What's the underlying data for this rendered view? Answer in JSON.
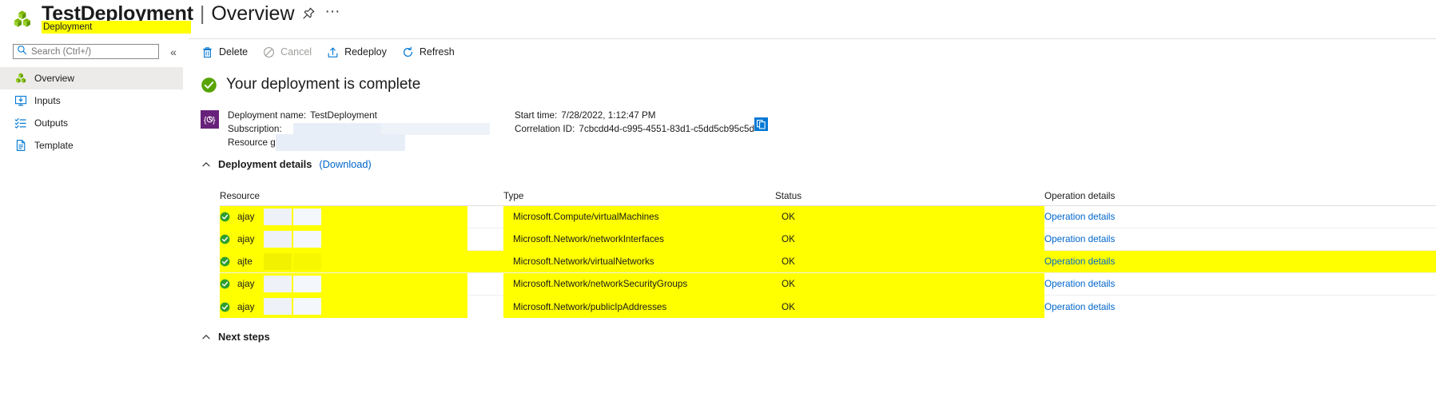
{
  "header": {
    "resource_icon": "cubes-icon",
    "title": "TestDeployment",
    "separator": "|",
    "subtitle_view": "Overview",
    "badge": "Deployment",
    "pin_icon": "pin-icon",
    "more_icon": "ellipsis-icon"
  },
  "search": {
    "placeholder": "Search (Ctrl+/)",
    "value": "",
    "icon": "search-icon",
    "collapse_icon": "chevron-double-left-icon"
  },
  "sidebar": {
    "items": [
      {
        "label": "Overview",
        "icon": "cubes-icon",
        "active": true
      },
      {
        "label": "Inputs",
        "icon": "inputs-monitor-icon",
        "active": false
      },
      {
        "label": "Outputs",
        "icon": "outputs-list-icon",
        "active": false
      },
      {
        "label": "Template",
        "icon": "document-icon",
        "active": false
      }
    ]
  },
  "command_bar": {
    "items": [
      {
        "label": "Delete",
        "icon": "trash-icon",
        "disabled": false
      },
      {
        "label": "Cancel",
        "icon": "cancel-circle-icon",
        "disabled": true
      },
      {
        "label": "Redeploy",
        "icon": "upload-box-icon",
        "disabled": false
      },
      {
        "label": "Refresh",
        "icon": "refresh-icon",
        "disabled": false
      }
    ]
  },
  "status": {
    "headline": "Your deployment is complete",
    "icon": "green-check-circle-icon"
  },
  "deployment_meta": {
    "icon": "arm-template-icon",
    "deployment_name_label": "Deployment name:",
    "deployment_name_value": "TestDeployment",
    "subscription_label": "Subscription:",
    "subscription_value": "",
    "resource_group_label": "Resource group:",
    "resource_group_value": "",
    "start_time_label": "Start time:",
    "start_time_value": "7/28/2022, 1:12:47 PM",
    "correlation_id_label": "Correlation ID:",
    "correlation_id_value": "7cbcdd4d-c995-4551-83d1-c5dd5cb95c5d",
    "copy_icon": "copy-icon"
  },
  "deployment_details": {
    "title": "Deployment details",
    "download_link": "(Download)",
    "chevron": "chevron-up-icon",
    "columns": [
      "Resource",
      "Type",
      "Status",
      "Operation details"
    ],
    "rows": [
      {
        "resource": "ajay",
        "type": "Microsoft.Compute/virtualMachines",
        "status": "OK",
        "operation": "Operation details",
        "full_row_highlight": false
      },
      {
        "resource": "ajay",
        "type": "Microsoft.Network/networkInterfaces",
        "status": "OK",
        "operation": "Operation details",
        "full_row_highlight": false
      },
      {
        "resource": "ajte",
        "type": "Microsoft.Network/virtualNetworks",
        "status": "OK",
        "operation": "Operation details",
        "full_row_highlight": true
      },
      {
        "resource": "ajay",
        "type": "Microsoft.Network/networkSecurityGroups",
        "status": "OK",
        "operation": "Operation details",
        "full_row_highlight": false
      },
      {
        "resource": "ajay",
        "type": "Microsoft.Network/publicIpAddresses",
        "status": "OK",
        "operation": "Operation details",
        "full_row_highlight": false
      }
    ]
  },
  "next_steps": {
    "title": "Next steps",
    "chevron": "chevron-up-icon"
  },
  "colors": {
    "highlight": "#ffff00",
    "link": "#0066cc",
    "success_green": "#57a300",
    "accent_blue": "#0078d4",
    "purple": "#68217a",
    "redaction": "#e8eef7"
  }
}
